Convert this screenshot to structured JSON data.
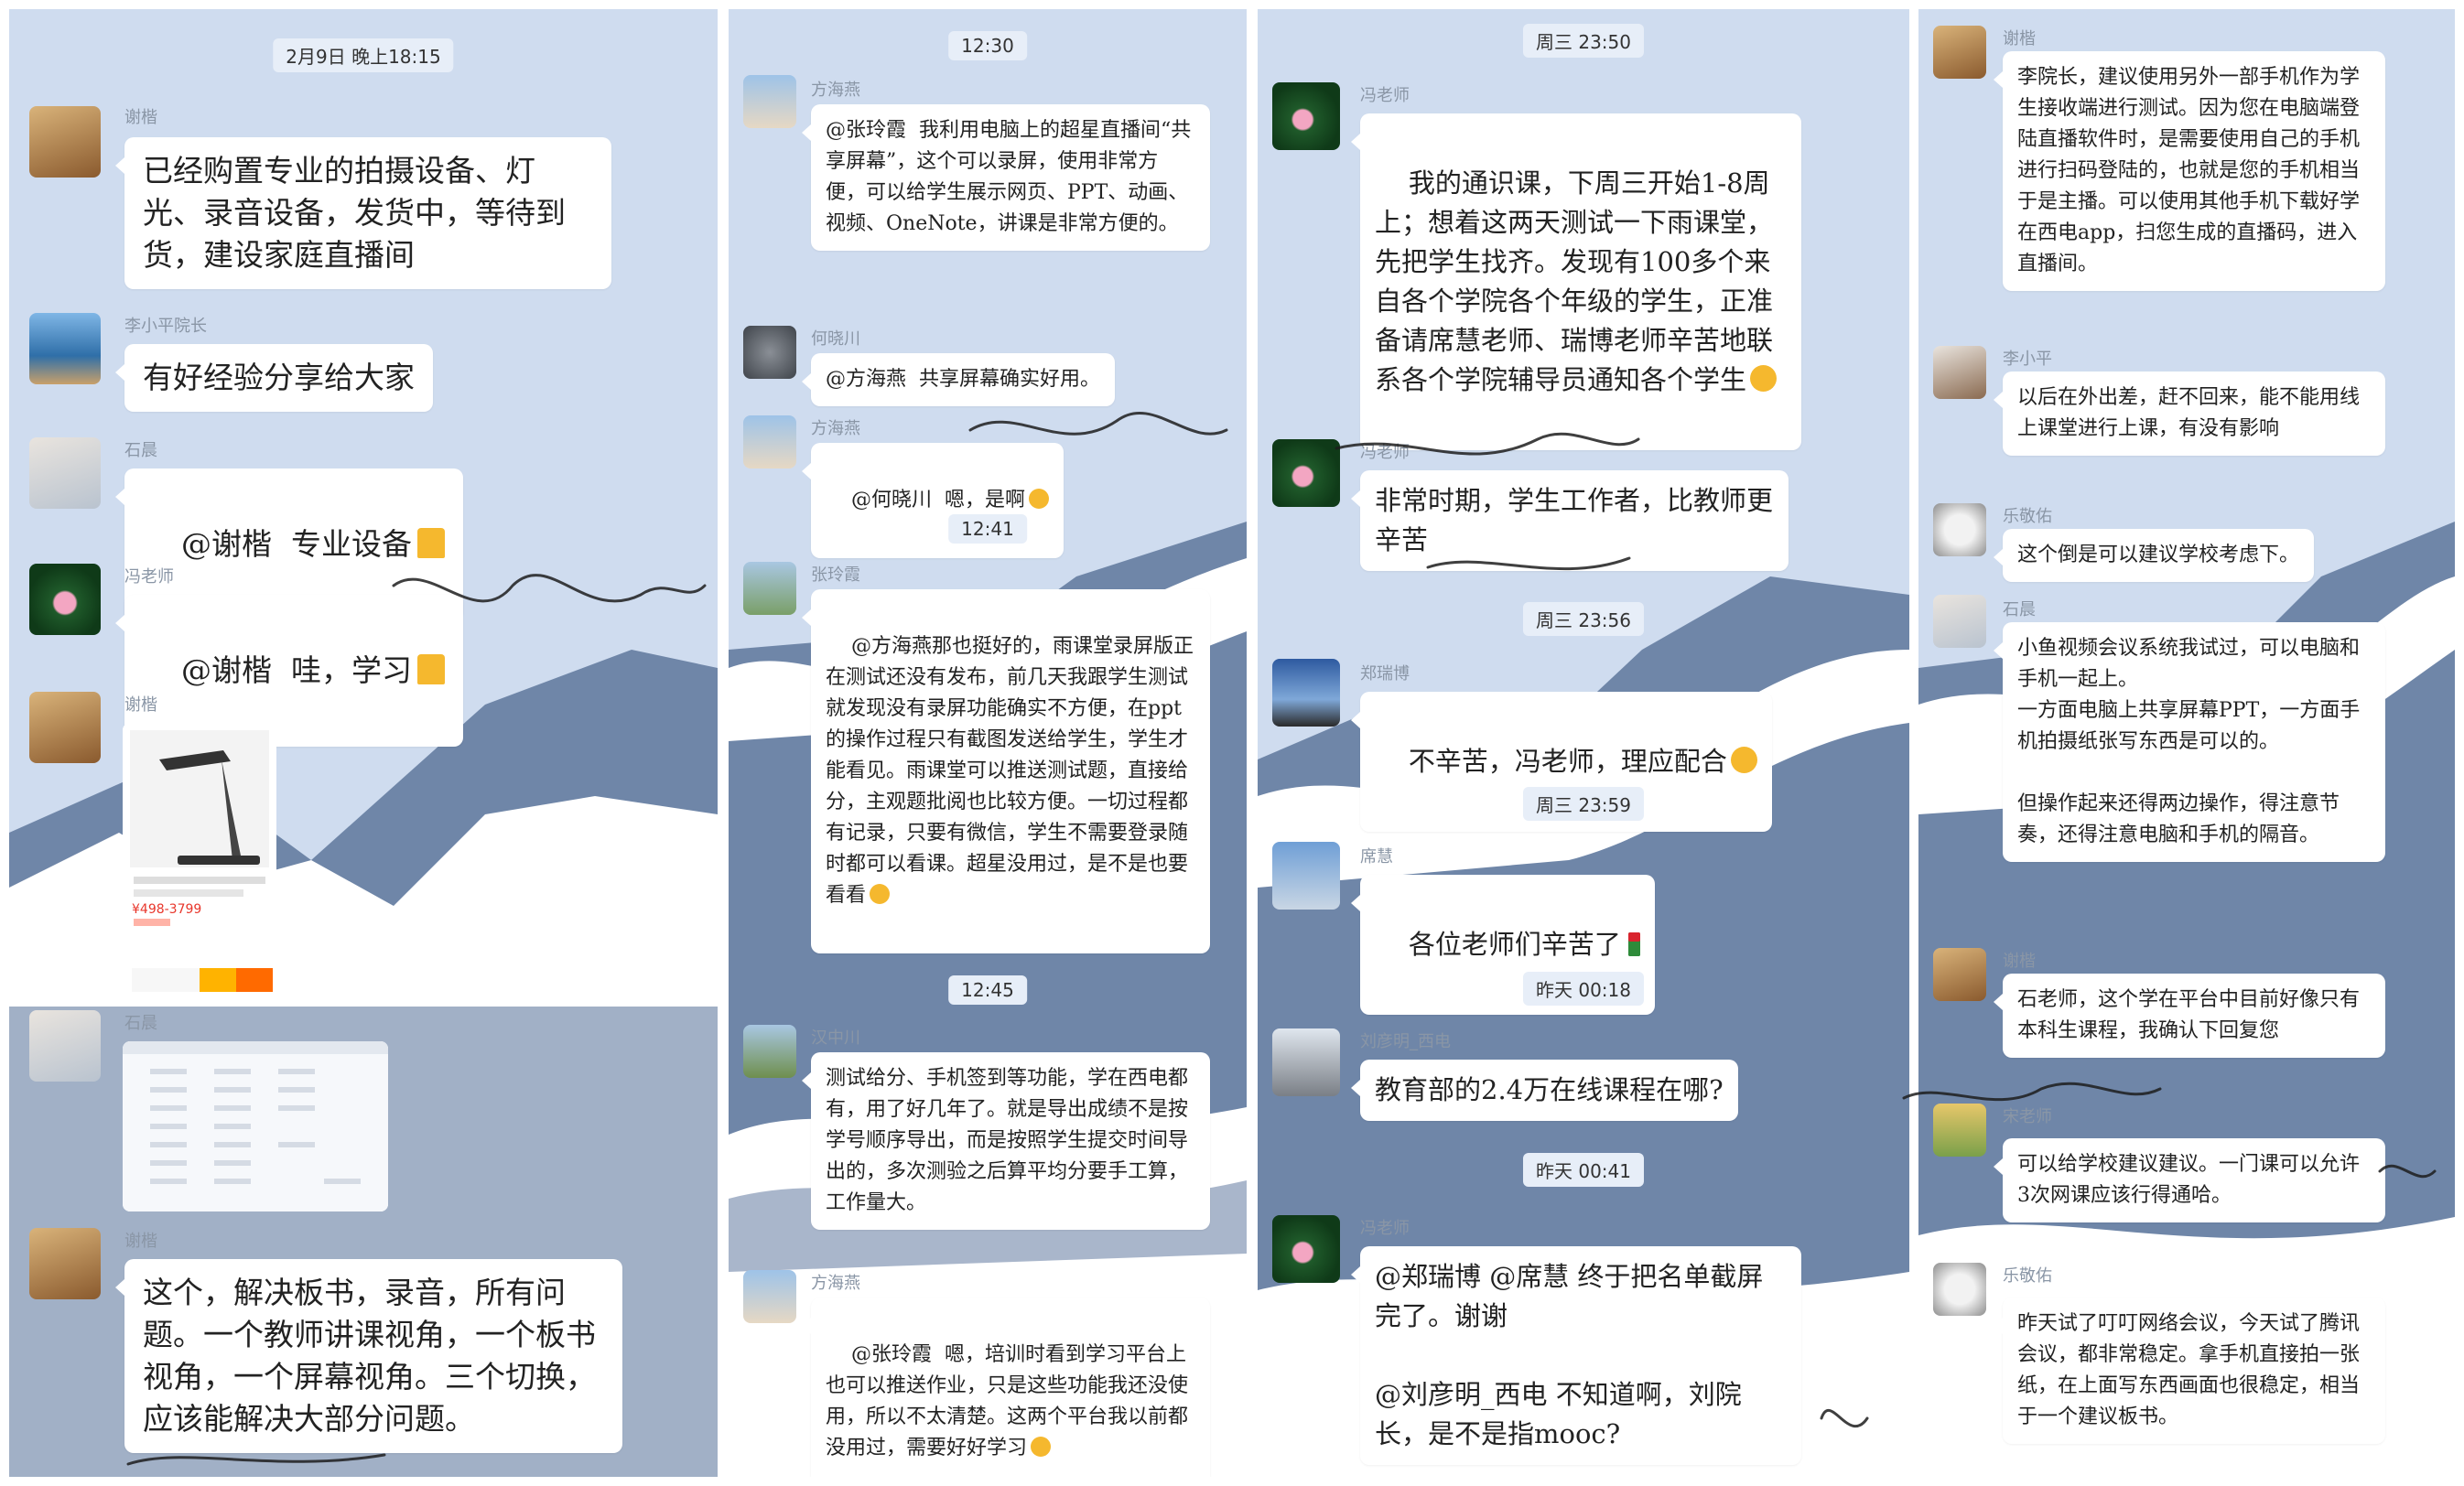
{
  "colors": {
    "panel_bg": "#cfdcef",
    "bubble": "#ffffff",
    "timestamp_bg": "#e7eef8",
    "mountain": "#6f86a8",
    "snow": "#ffffff"
  },
  "panels": [
    {
      "timestamps": [
        "2月9日 晚上18:15"
      ],
      "messages": [
        {
          "sender": "谢楷",
          "text": "已经购置专业的拍摄设备、灯光、录音设备，发货中，等待到货，建设家庭直播间"
        },
        {
          "sender": "李小平院长",
          "text": "有好经验分享给大家"
        },
        {
          "sender": "石晨",
          "text": "@谢楷  专业设备"
        },
        {
          "sender": "冯老师",
          "text": "@谢楷  哇，学习"
        },
        {
          "sender": "谢楷",
          "image": "product-screenshot",
          "caption": "¥498-3799"
        },
        {
          "sender": "石晨",
          "image": "software-screenshot"
        },
        {
          "sender": "谢楷",
          "text": "这个，解决板书，录音，所有问题。一个教师讲课视角，一个板书视角，一个屏幕视角。三个切换，应该能解决大部分问题。"
        }
      ]
    },
    {
      "timestamps": [
        "12:30",
        "12:41",
        "12:45"
      ],
      "messages": [
        {
          "sender": "方海燕",
          "text": "@张玲霞  我利用电脑上的超星直播间“共享屏幕”，这个可以录屏，使用非常方便，可以给学生展示网页、PPT、动画、视频、OneNote，讲课是非常方便的。"
        },
        {
          "sender": "何晓川",
          "text": "@方海燕  共享屏幕确实好用。"
        },
        {
          "sender": "方海燕",
          "text": "@何晓川  嗯，是啊"
        },
        {
          "sender": "张玲霞",
          "text": "@方海燕那也挺好的，雨课堂录屏版正在测试还没有发布，前几天我跟学生测试就发现没有录屏功能确实不方便，在ppt的操作过程只有截图发送给学生，学生才能看见。雨课堂可以推送测试题，直接给分，主观题批阅也比较方便。一切过程都有记录，只要有微信，学生不需要登录随时都可以看课。超星没用过，是不是也要看看"
        },
        {
          "sender": "汉中川",
          "text": "测试给分、手机签到等功能，学在西电都有，用了好几年了。就是导出成绩不是按学号顺序导出，而是按照学生提交时间导出的，多次测验之后算平均分要手工算，工作量大。"
        },
        {
          "sender": "方海燕",
          "text": "@张玲霞  嗯，培训时看到学习平台上也可以推送作业，只是这些功能我还没使用，所以不太清楚。这两个平台我以前都没用过，需要好好学习"
        }
      ]
    },
    {
      "timestamps": [
        "周三 23:50",
        "周三 23:56",
        "周三 23:59",
        "昨天 00:18",
        "昨天 00:41"
      ],
      "messages": [
        {
          "sender": "冯老师",
          "text": "我的通识课，下周三开始1-8周上；想着这两天测试一下雨课堂，先把学生找齐。发现有100多个来自各个学院各个年级的学生，正准备请席慧老师、瑞博老师辛苦地联系各个学院辅导员通知各个学生"
        },
        {
          "sender": "冯老师",
          "text": "非常时期，学生工作者，比教师更辛苦"
        },
        {
          "sender": "郑瑞博",
          "text": "不辛苦，冯老师，理应配合"
        },
        {
          "sender": "席慧",
          "text": "各位老师们辛苦了"
        },
        {
          "sender": "刘彦明_西电",
          "text": "教育部的2.4万在线课程在哪?"
        },
        {
          "sender": "冯老师",
          "text": "@郑瑞博 @席慧 终于把名单截屏完了。谢谢\n\n@刘彦明_西电 不知道啊，刘院长，是不是指mooc?"
        }
      ]
    },
    {
      "timestamps": [],
      "messages": [
        {
          "sender": "谢楷",
          "text": "李院长，建议使用另外一部手机作为学生接收端进行测试。因为您在电脑端登陆直播软件时，是需要使用自己的手机进行扫码登陆的，也就是您的手机相当于是主播。可以使用其他手机下载好学在西电app，扫您生成的直播码，进入直播间。"
        },
        {
          "sender": "李小平",
          "text": "以后在外出差，赶不回来，能不能用线上课堂进行上课，有没有影响"
        },
        {
          "sender": "乐敬佑",
          "text": "这个倒是可以建议学校考虑下。"
        },
        {
          "sender": "石晨",
          "text": "小鱼视频会议系统我试过，可以电脑和手机一起上。\n一方面电脑上共享屏幕PPT，一方面手机拍摄纸张写东西是可以的。\n\n但操作起来还得两边操作，得注意节奏，还得注意电脑和手机的隔音。"
        },
        {
          "sender": "谢楷",
          "text": "石老师，这个学在平台中目前好像只有本科生课程，我确认下回复您"
        },
        {
          "sender": "宋老师",
          "text": "可以给学校建议建议。一门课可以允许3次网课应该行得通哈。"
        },
        {
          "sender": "乐敬佑",
          "text": "昨天试了叮叮网络会议，今天试了腾讯会议，都非常稳定。拿手机直接拍一张纸，在上面写东西画面也很稳定，相当于一个建议板书。"
        }
      ]
    }
  ],
  "handwriting": [
    "真可以放活你",
    "可以系活泳"
  ]
}
